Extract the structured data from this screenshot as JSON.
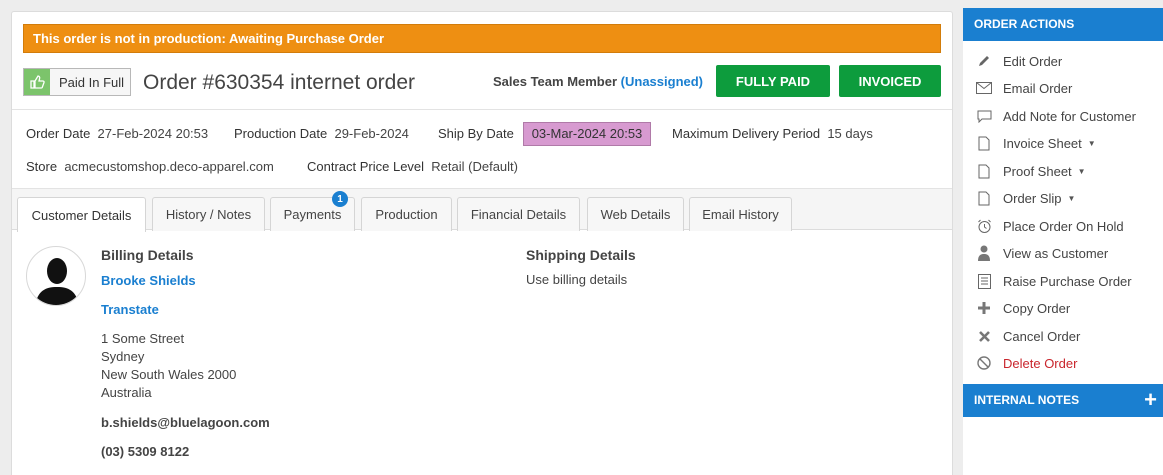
{
  "alert": {
    "text": "This order is not in production: Awaiting Purchase Order"
  },
  "header": {
    "paid_badge": "Paid In Full",
    "order_title": "Order #630354 internet order",
    "sales_team_label": "Sales Team Member",
    "sales_team_value": "(Unassigned)",
    "btn_fully_paid": "FULLY PAID",
    "btn_invoiced": "INVOICED"
  },
  "meta": {
    "order_date_label": "Order Date",
    "order_date": "27-Feb-2024 20:53",
    "production_date_label": "Production Date",
    "production_date": "29-Feb-2024",
    "ship_by_label": "Ship By Date",
    "ship_by": "03-Mar-2024 20:53",
    "max_delivery_label": "Maximum Delivery Period",
    "max_delivery": "15 days",
    "store_label": "Store",
    "store": "acmecustomshop.deco-apparel.com",
    "contract_label": "Contract Price Level",
    "contract": "Retail (Default)"
  },
  "tabs": [
    {
      "label": "Customer Details"
    },
    {
      "label": "History / Notes"
    },
    {
      "label": "Payments",
      "badge": "1"
    },
    {
      "label": "Production"
    },
    {
      "label": "Financial Details"
    },
    {
      "label": "Web Details"
    },
    {
      "label": "Email History"
    }
  ],
  "billing": {
    "heading": "Billing Details",
    "name": "Brooke Shields",
    "company": "Transtate",
    "address": [
      "1 Some Street",
      "Sydney",
      "New South Wales 2000",
      "Australia"
    ],
    "email": "b.shields@bluelagoon.com",
    "phone": "(03) 5309 8122"
  },
  "shipping": {
    "heading": "Shipping Details",
    "text": "Use billing details"
  },
  "sidebar": {
    "actions_heading": "ORDER ACTIONS",
    "items": [
      {
        "label": "Edit Order",
        "icon": "pencil-icon"
      },
      {
        "label": "Email Order",
        "icon": "envelope-icon"
      },
      {
        "label": "Add Note for Customer",
        "icon": "comment-icon"
      },
      {
        "label": "Invoice Sheet",
        "icon": "document-icon",
        "dropdown": true
      },
      {
        "label": "Proof Sheet",
        "icon": "document-icon",
        "dropdown": true
      },
      {
        "label": "Order Slip",
        "icon": "document-icon",
        "dropdown": true
      },
      {
        "label": "Place Order On Hold",
        "icon": "alarm-clock-icon"
      },
      {
        "label": "View as Customer",
        "icon": "user-icon"
      },
      {
        "label": "Raise Purchase Order",
        "icon": "list-document-icon"
      },
      {
        "label": "Copy Order",
        "icon": "plus-icon"
      },
      {
        "label": "Cancel Order",
        "icon": "x-icon"
      },
      {
        "label": "Delete Order",
        "icon": "ban-icon",
        "danger": true
      }
    ],
    "notes_heading": "INTERNAL NOTES",
    "notes_add": "+"
  },
  "colors": {
    "alert": "#ee8f12",
    "primary": "#1a7fd0",
    "green": "#0d9c3d",
    "ship_highlight": "#d79ad0",
    "danger": "#c9252c"
  }
}
